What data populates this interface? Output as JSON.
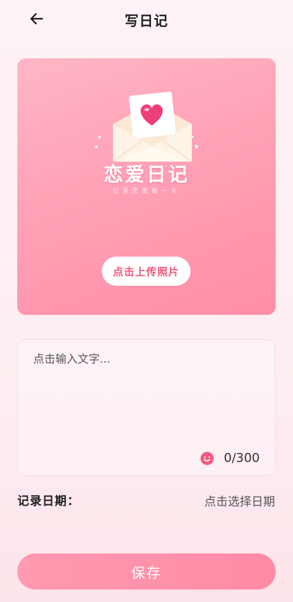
{
  "header": {
    "back_icon": "arrow-left-icon",
    "title": "写日记"
  },
  "upload_card": {
    "illustration_icon": "heart-envelope-icon",
    "brand_title": "恋爱日记",
    "brand_subtitle": "记录恋爱每一天",
    "upload_button_label": "点击上传照片",
    "colors": {
      "card_start": "#ffb6c6",
      "card_end": "#ff8ea7",
      "button_text": "#f2577d"
    }
  },
  "editor": {
    "placeholder": "点击输入文字...",
    "value": "",
    "emoji_icon": "smile-icon",
    "char_count": "0/300"
  },
  "date": {
    "label": "记录日期：",
    "picker_text": "点击选择日期"
  },
  "actions": {
    "save_label": "保存",
    "save_color": "#ff8aa5"
  }
}
